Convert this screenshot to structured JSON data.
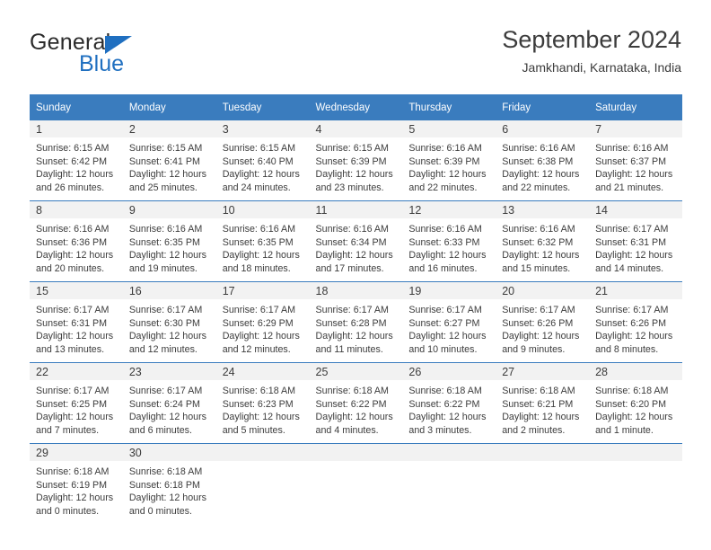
{
  "brand": {
    "name_part1": "General",
    "name_part2": "Blue",
    "triangle_color": "#1f6fc0",
    "text_color": "#2b2b2b"
  },
  "header": {
    "title": "September 2024",
    "subtitle": "Jamkhandi, Karnataka, India"
  },
  "theme": {
    "header_blue": "#3a7cbe",
    "daynum_band": "#f2f2f2",
    "text": "#3c3c3c"
  },
  "calendar": {
    "weekday_headers": [
      "Sunday",
      "Monday",
      "Tuesday",
      "Wednesday",
      "Thursday",
      "Friday",
      "Saturday"
    ],
    "weeks": [
      [
        {
          "day": "1",
          "sunrise": "Sunrise: 6:15 AM",
          "sunset": "Sunset: 6:42 PM",
          "daylight1": "Daylight: 12 hours",
          "daylight2": "and 26 minutes."
        },
        {
          "day": "2",
          "sunrise": "Sunrise: 6:15 AM",
          "sunset": "Sunset: 6:41 PM",
          "daylight1": "Daylight: 12 hours",
          "daylight2": "and 25 minutes."
        },
        {
          "day": "3",
          "sunrise": "Sunrise: 6:15 AM",
          "sunset": "Sunset: 6:40 PM",
          "daylight1": "Daylight: 12 hours",
          "daylight2": "and 24 minutes."
        },
        {
          "day": "4",
          "sunrise": "Sunrise: 6:15 AM",
          "sunset": "Sunset: 6:39 PM",
          "daylight1": "Daylight: 12 hours",
          "daylight2": "and 23 minutes."
        },
        {
          "day": "5",
          "sunrise": "Sunrise: 6:16 AM",
          "sunset": "Sunset: 6:39 PM",
          "daylight1": "Daylight: 12 hours",
          "daylight2": "and 22 minutes."
        },
        {
          "day": "6",
          "sunrise": "Sunrise: 6:16 AM",
          "sunset": "Sunset: 6:38 PM",
          "daylight1": "Daylight: 12 hours",
          "daylight2": "and 22 minutes."
        },
        {
          "day": "7",
          "sunrise": "Sunrise: 6:16 AM",
          "sunset": "Sunset: 6:37 PM",
          "daylight1": "Daylight: 12 hours",
          "daylight2": "and 21 minutes."
        }
      ],
      [
        {
          "day": "8",
          "sunrise": "Sunrise: 6:16 AM",
          "sunset": "Sunset: 6:36 PM",
          "daylight1": "Daylight: 12 hours",
          "daylight2": "and 20 minutes."
        },
        {
          "day": "9",
          "sunrise": "Sunrise: 6:16 AM",
          "sunset": "Sunset: 6:35 PM",
          "daylight1": "Daylight: 12 hours",
          "daylight2": "and 19 minutes."
        },
        {
          "day": "10",
          "sunrise": "Sunrise: 6:16 AM",
          "sunset": "Sunset: 6:35 PM",
          "daylight1": "Daylight: 12 hours",
          "daylight2": "and 18 minutes."
        },
        {
          "day": "11",
          "sunrise": "Sunrise: 6:16 AM",
          "sunset": "Sunset: 6:34 PM",
          "daylight1": "Daylight: 12 hours",
          "daylight2": "and 17 minutes."
        },
        {
          "day": "12",
          "sunrise": "Sunrise: 6:16 AM",
          "sunset": "Sunset: 6:33 PM",
          "daylight1": "Daylight: 12 hours",
          "daylight2": "and 16 minutes."
        },
        {
          "day": "13",
          "sunrise": "Sunrise: 6:16 AM",
          "sunset": "Sunset: 6:32 PM",
          "daylight1": "Daylight: 12 hours",
          "daylight2": "and 15 minutes."
        },
        {
          "day": "14",
          "sunrise": "Sunrise: 6:17 AM",
          "sunset": "Sunset: 6:31 PM",
          "daylight1": "Daylight: 12 hours",
          "daylight2": "and 14 minutes."
        }
      ],
      [
        {
          "day": "15",
          "sunrise": "Sunrise: 6:17 AM",
          "sunset": "Sunset: 6:31 PM",
          "daylight1": "Daylight: 12 hours",
          "daylight2": "and 13 minutes."
        },
        {
          "day": "16",
          "sunrise": "Sunrise: 6:17 AM",
          "sunset": "Sunset: 6:30 PM",
          "daylight1": "Daylight: 12 hours",
          "daylight2": "and 12 minutes."
        },
        {
          "day": "17",
          "sunrise": "Sunrise: 6:17 AM",
          "sunset": "Sunset: 6:29 PM",
          "daylight1": "Daylight: 12 hours",
          "daylight2": "and 12 minutes."
        },
        {
          "day": "18",
          "sunrise": "Sunrise: 6:17 AM",
          "sunset": "Sunset: 6:28 PM",
          "daylight1": "Daylight: 12 hours",
          "daylight2": "and 11 minutes."
        },
        {
          "day": "19",
          "sunrise": "Sunrise: 6:17 AM",
          "sunset": "Sunset: 6:27 PM",
          "daylight1": "Daylight: 12 hours",
          "daylight2": "and 10 minutes."
        },
        {
          "day": "20",
          "sunrise": "Sunrise: 6:17 AM",
          "sunset": "Sunset: 6:26 PM",
          "daylight1": "Daylight: 12 hours",
          "daylight2": "and 9 minutes."
        },
        {
          "day": "21",
          "sunrise": "Sunrise: 6:17 AM",
          "sunset": "Sunset: 6:26 PM",
          "daylight1": "Daylight: 12 hours",
          "daylight2": "and 8 minutes."
        }
      ],
      [
        {
          "day": "22",
          "sunrise": "Sunrise: 6:17 AM",
          "sunset": "Sunset: 6:25 PM",
          "daylight1": "Daylight: 12 hours",
          "daylight2": "and 7 minutes."
        },
        {
          "day": "23",
          "sunrise": "Sunrise: 6:17 AM",
          "sunset": "Sunset: 6:24 PM",
          "daylight1": "Daylight: 12 hours",
          "daylight2": "and 6 minutes."
        },
        {
          "day": "24",
          "sunrise": "Sunrise: 6:18 AM",
          "sunset": "Sunset: 6:23 PM",
          "daylight1": "Daylight: 12 hours",
          "daylight2": "and 5 minutes."
        },
        {
          "day": "25",
          "sunrise": "Sunrise: 6:18 AM",
          "sunset": "Sunset: 6:22 PM",
          "daylight1": "Daylight: 12 hours",
          "daylight2": "and 4 minutes."
        },
        {
          "day": "26",
          "sunrise": "Sunrise: 6:18 AM",
          "sunset": "Sunset: 6:22 PM",
          "daylight1": "Daylight: 12 hours",
          "daylight2": "and 3 minutes."
        },
        {
          "day": "27",
          "sunrise": "Sunrise: 6:18 AM",
          "sunset": "Sunset: 6:21 PM",
          "daylight1": "Daylight: 12 hours",
          "daylight2": "and 2 minutes."
        },
        {
          "day": "28",
          "sunrise": "Sunrise: 6:18 AM",
          "sunset": "Sunset: 6:20 PM",
          "daylight1": "Daylight: 12 hours",
          "daylight2": "and 1 minute."
        }
      ],
      [
        {
          "day": "29",
          "sunrise": "Sunrise: 6:18 AM",
          "sunset": "Sunset: 6:19 PM",
          "daylight1": "Daylight: 12 hours",
          "daylight2": "and 0 minutes."
        },
        {
          "day": "30",
          "sunrise": "Sunrise: 6:18 AM",
          "sunset": "Sunset: 6:18 PM",
          "daylight1": "Daylight: 12 hours",
          "daylight2": "and 0 minutes."
        },
        {
          "day": "",
          "sunrise": "",
          "sunset": "",
          "daylight1": "",
          "daylight2": ""
        },
        {
          "day": "",
          "sunrise": "",
          "sunset": "",
          "daylight1": "",
          "daylight2": ""
        },
        {
          "day": "",
          "sunrise": "",
          "sunset": "",
          "daylight1": "",
          "daylight2": ""
        },
        {
          "day": "",
          "sunrise": "",
          "sunset": "",
          "daylight1": "",
          "daylight2": ""
        },
        {
          "day": "",
          "sunrise": "",
          "sunset": "",
          "daylight1": "",
          "daylight2": ""
        }
      ]
    ]
  }
}
